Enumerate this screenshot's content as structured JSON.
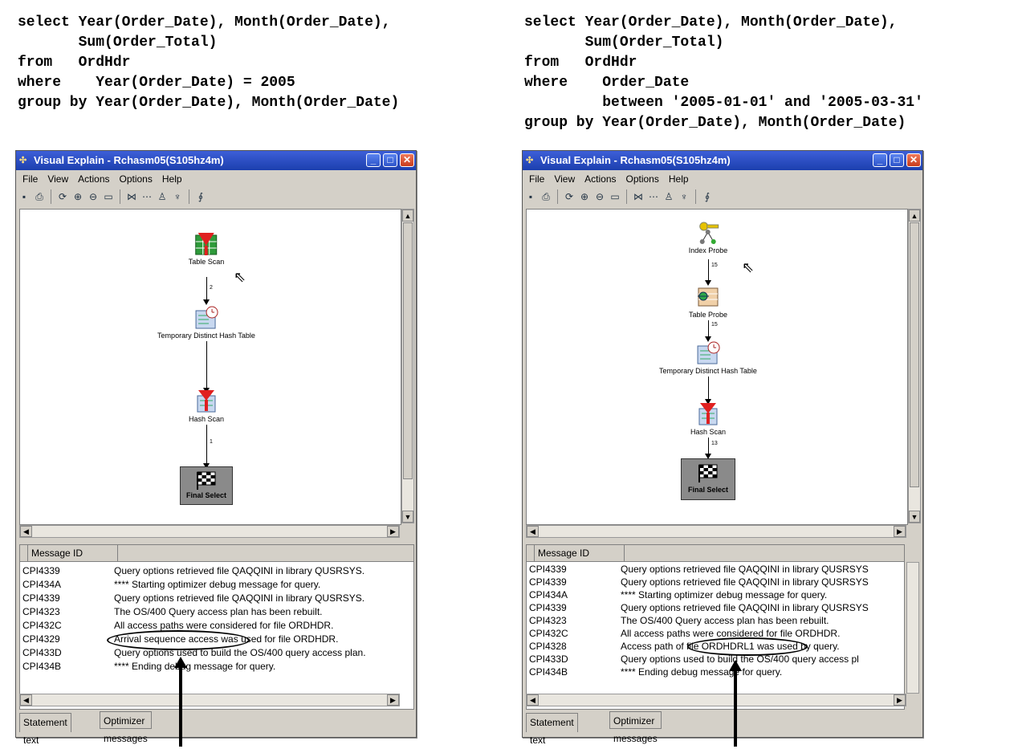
{
  "left": {
    "sql": "select Year(Order_Date), Month(Order_Date),\n       Sum(Order_Total)\nfrom   OrdHdr\nwhere    Year(Order_Date) = 2005\ngroup by Year(Order_Date), Month(Order_Date)",
    "window_title": "Visual Explain - Rchasm05(S105hz4m)",
    "menu": [
      "File",
      "View",
      "Actions",
      "Options",
      "Help"
    ],
    "nodes": [
      "Table Scan",
      "Temporary Distinct Hash Table",
      "Hash Scan",
      "Final Select"
    ],
    "edge_labels": [
      "2",
      "1"
    ],
    "column_header": "Message ID",
    "messages": [
      {
        "id": "CPI4339",
        "text": "Query options retrieved file QAQQINI in library QUSRSYS."
      },
      {
        "id": "CPI434A",
        "text": "**** Starting optimizer debug message for query."
      },
      {
        "id": "CPI4339",
        "text": "Query options retrieved file QAQQINI in library QUSRSYS."
      },
      {
        "id": "CPI4323",
        "text": "The OS/400 Query access plan has been rebuilt."
      },
      {
        "id": "CPI432C",
        "text": "All access paths were considered for file ORDHDR."
      },
      {
        "id": "CPI4329",
        "text": "Arrival sequence access was used for file ORDHDR."
      },
      {
        "id": "CPI433D",
        "text": "Query options used to build the OS/400 query access plan."
      },
      {
        "id": "CPI434B",
        "text": "**** Ending debug message for query."
      }
    ],
    "tabs": [
      "Statement text",
      "Optimizer messages"
    ]
  },
  "right": {
    "sql": "select Year(Order_Date), Month(Order_Date),\n       Sum(Order_Total)\nfrom   OrdHdr\nwhere    Order_Date\n         between '2005-01-01' and '2005-03-31'\ngroup by Year(Order_Date), Month(Order_Date)",
    "window_title": "Visual Explain - Rchasm05(S105hz4m)",
    "menu": [
      "File",
      "View",
      "Actions",
      "Options",
      "Help"
    ],
    "nodes": [
      "Index Probe",
      "Table Probe",
      "Temporary Distinct Hash Table",
      "Hash Scan",
      "Final Select"
    ],
    "edge_labels": [
      "15",
      "15",
      "13"
    ],
    "column_header": "Message ID",
    "messages": [
      {
        "id": "CPI4339",
        "text": "Query options retrieved file QAQQINI in library QUSRSYS"
      },
      {
        "id": "CPI4339",
        "text": "Query options retrieved file QAQQINI in library QUSRSYS"
      },
      {
        "id": "CPI434A",
        "text": "**** Starting optimizer debug message for query."
      },
      {
        "id": "CPI4339",
        "text": "Query options retrieved file QAQQINI in library QUSRSYS"
      },
      {
        "id": "CPI4323",
        "text": "The OS/400 Query access plan has been rebuilt."
      },
      {
        "id": "CPI432C",
        "text": "All access paths were considered for file ORDHDR."
      },
      {
        "id": "CPI4328",
        "text": "Access path of file ORDHDRL1 was used by query."
      },
      {
        "id": "CPI433D",
        "text": "Query options used to build the OS/400 query access pl"
      },
      {
        "id": "CPI434B",
        "text": "**** Ending debug message for query."
      }
    ],
    "tabs": [
      "Statement text",
      "Optimizer messages"
    ]
  },
  "colors": {
    "titlebar": "#1c3fae",
    "close_button": "#c73b1c",
    "scan_red": "#e02020",
    "window_bg": "#d4d0c8"
  },
  "icons": [
    "save-icon",
    "print-icon",
    "refresh-icon",
    "zoom-in-icon",
    "zoom-out-icon",
    "overview-icon",
    "graph-icon",
    "network-icon",
    "people-icon",
    "tree-icon",
    "link-icon"
  ]
}
